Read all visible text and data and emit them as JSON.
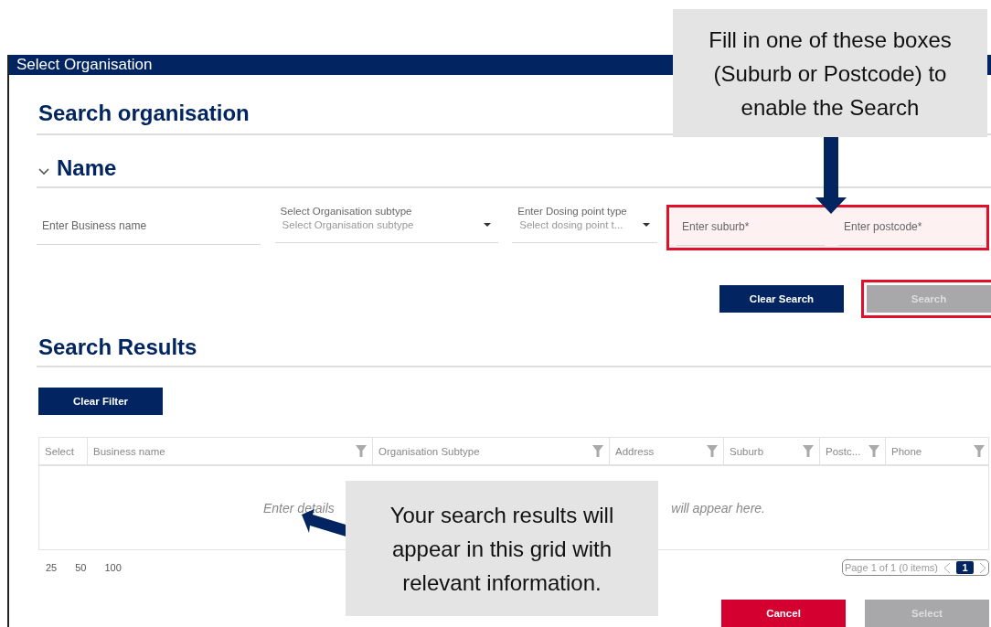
{
  "window": {
    "title": "Select Organisation"
  },
  "search_title": "Search organisation",
  "name_section": {
    "title": "Name",
    "expanded": true
  },
  "fields": [
    {
      "kind": "text",
      "placeholder": "Enter Business name",
      "highlighted": false
    },
    {
      "kind": "select",
      "label": "Select Organisation subtype",
      "placeholder": "Select Organisation subtype",
      "highlighted": false
    },
    {
      "kind": "select",
      "label": "Enter Dosing point type",
      "placeholder": "Select dosing point t...",
      "highlighted": false
    },
    {
      "kind": "text",
      "placeholder": "Enter suburb*",
      "highlighted": true
    },
    {
      "kind": "text",
      "placeholder": "Enter postcode*",
      "highlighted": true
    }
  ],
  "search_buttons": [
    {
      "label": "Clear Search",
      "disabled": false,
      "highlighted": false
    },
    {
      "label": "Search",
      "disabled": true,
      "highlighted": true
    }
  ],
  "results": {
    "title": "Search Results",
    "clear_filter": "Clear Filter",
    "columns": [
      {
        "label": "Select",
        "filterable": false
      },
      {
        "label": "Business name",
        "filterable": true
      },
      {
        "label": "Organisation Subtype",
        "filterable": true
      },
      {
        "label": "Address",
        "filterable": true
      },
      {
        "label": "Suburb",
        "filterable": true
      },
      {
        "label": "Postc...",
        "filterable": true
      },
      {
        "label": "Phone",
        "filterable": true
      }
    ],
    "empty_message": [
      "Enter details",
      "will appear here."
    ],
    "page_sizes": [
      "25",
      "50",
      "100"
    ],
    "pager": {
      "info": "Page 1 of 1 (0 items)",
      "pages": [
        {
          "label": "1",
          "selected": true
        }
      ]
    }
  },
  "footer_buttons": [
    {
      "label": "Cancel",
      "kind": "danger",
      "disabled": false
    },
    {
      "label": "Select",
      "kind": "primary",
      "disabled": true
    }
  ],
  "callouts": [
    {
      "text": "Fill in one of these boxes (Suburb or Postcode) to enable the Search"
    },
    {
      "text": "Your search results will appear in this grid with relevant information."
    }
  ]
}
